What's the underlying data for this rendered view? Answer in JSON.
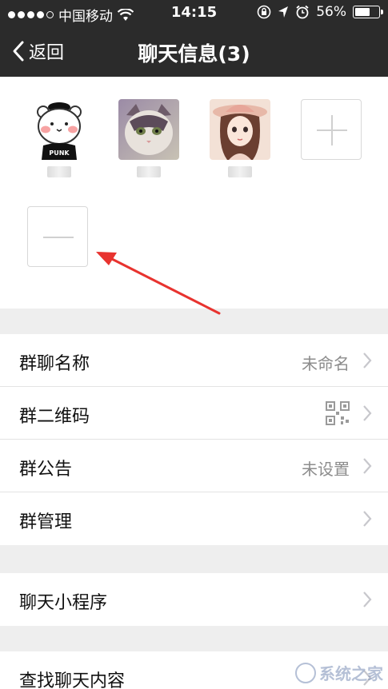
{
  "status": {
    "carrier": "中国移动",
    "time": "14:15",
    "battery": "56%",
    "battery_level": 0.56
  },
  "nav": {
    "back_label": "返回",
    "title": "聊天信息(3)"
  },
  "members": [
    {
      "name": "",
      "avatar": "panda-punk"
    },
    {
      "name": "",
      "avatar": "cat"
    },
    {
      "name": "",
      "avatar": "girl-hat"
    }
  ],
  "settings": {
    "group_name": {
      "label": "群聊名称",
      "value": "未命名"
    },
    "qr_code": {
      "label": "群二维码"
    },
    "notice": {
      "label": "群公告",
      "value": "未设置"
    },
    "manage": {
      "label": "群管理"
    },
    "mini_program": {
      "label": "聊天小程序"
    },
    "search": {
      "label": "查找聊天内容"
    }
  },
  "avatar_text": {
    "punk": "PUNK"
  },
  "watermark": "系统之家",
  "colors": {
    "nav_bg": "#2b2b2b",
    "page_bg": "#eeeeee",
    "arrow": "#e8332f"
  }
}
